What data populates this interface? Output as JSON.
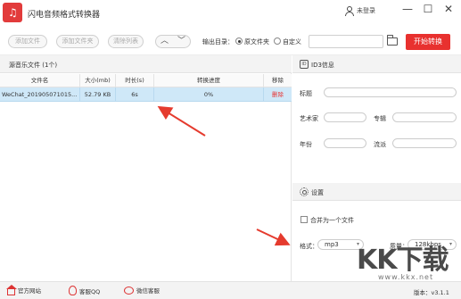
{
  "app": {
    "title": "闪电音频格式转换器"
  },
  "user": {
    "login_label": "未登录"
  },
  "window": {
    "minimize": "—",
    "maximize": "☐",
    "close": "✕"
  },
  "toolbar": {
    "add_file": "添加文件",
    "add_folder": "添加文件夹",
    "clear_list": "清除列表",
    "up": "︿",
    "down": "﹀",
    "output_label": "输出目录：",
    "radio_original": "原文件夹",
    "radio_custom": "自定义",
    "output_path": "",
    "start": "开始转换"
  },
  "source": {
    "title": "源音乐文件 (1个)",
    "columns": [
      "文件名",
      "大小(mb)",
      "时长(s)",
      "转换进度",
      "移除"
    ],
    "rows": [
      {
        "name": "WeChat_201905071015...",
        "size": "52.79 KB",
        "duration": "6s",
        "progress": "0%",
        "remove": "删除"
      }
    ]
  },
  "id3": {
    "title": "ID3信息",
    "title_label": "标题",
    "artist_label": "艺术家",
    "album_label": "专辑",
    "year_label": "年份",
    "genre_label": "流派"
  },
  "settings": {
    "title": "设置",
    "merge_label": "合并为一个文件",
    "format_label": "格式：",
    "format_value": "mp3",
    "quality_label": "质量：",
    "quality_value": "128kbps"
  },
  "status": {
    "website": "官方网站",
    "qq": "客服QQ",
    "wechat": "微信客服",
    "version": "版本：v3.1.1"
  },
  "watermark": {
    "text": "KK下载",
    "url": "www.kkx.net"
  },
  "colors": {
    "accent": "#e8312f",
    "selected_row": "#cfe8f8",
    "annotation": "#e53b2e"
  }
}
